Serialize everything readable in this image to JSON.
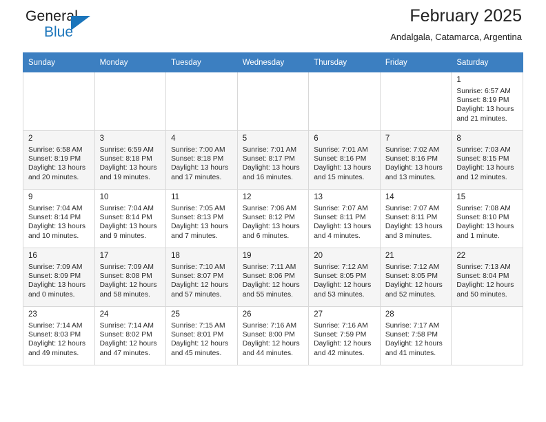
{
  "brand": {
    "name_top": "General",
    "name_bottom": "Blue",
    "accent_color": "#1b75bb"
  },
  "header": {
    "title": "February 2025",
    "subtitle": "Andalgala, Catamarca, Argentina"
  },
  "theme": {
    "header_row_bg": "#3c7fc1",
    "header_row_text": "#ffffff",
    "alt_row_bg": "#f5f5f5",
    "grid_border": "#d8d8d8"
  },
  "weekday_headers": [
    "Sunday",
    "Monday",
    "Tuesday",
    "Wednesday",
    "Thursday",
    "Friday",
    "Saturday"
  ],
  "weeks": [
    [
      {
        "empty": true
      },
      {
        "empty": true
      },
      {
        "empty": true
      },
      {
        "empty": true
      },
      {
        "empty": true
      },
      {
        "empty": true
      },
      {
        "day": "1",
        "sunrise": "Sunrise: 6:57 AM",
        "sunset": "Sunset: 8:19 PM",
        "daylight": "Daylight: 13 hours and 21 minutes."
      }
    ],
    [
      {
        "day": "2",
        "sunrise": "Sunrise: 6:58 AM",
        "sunset": "Sunset: 8:19 PM",
        "daylight": "Daylight: 13 hours and 20 minutes."
      },
      {
        "day": "3",
        "sunrise": "Sunrise: 6:59 AM",
        "sunset": "Sunset: 8:18 PM",
        "daylight": "Daylight: 13 hours and 19 minutes."
      },
      {
        "day": "4",
        "sunrise": "Sunrise: 7:00 AM",
        "sunset": "Sunset: 8:18 PM",
        "daylight": "Daylight: 13 hours and 17 minutes."
      },
      {
        "day": "5",
        "sunrise": "Sunrise: 7:01 AM",
        "sunset": "Sunset: 8:17 PM",
        "daylight": "Daylight: 13 hours and 16 minutes."
      },
      {
        "day": "6",
        "sunrise": "Sunrise: 7:01 AM",
        "sunset": "Sunset: 8:16 PM",
        "daylight": "Daylight: 13 hours and 15 minutes."
      },
      {
        "day": "7",
        "sunrise": "Sunrise: 7:02 AM",
        "sunset": "Sunset: 8:16 PM",
        "daylight": "Daylight: 13 hours and 13 minutes."
      },
      {
        "day": "8",
        "sunrise": "Sunrise: 7:03 AM",
        "sunset": "Sunset: 8:15 PM",
        "daylight": "Daylight: 13 hours and 12 minutes."
      }
    ],
    [
      {
        "day": "9",
        "sunrise": "Sunrise: 7:04 AM",
        "sunset": "Sunset: 8:14 PM",
        "daylight": "Daylight: 13 hours and 10 minutes."
      },
      {
        "day": "10",
        "sunrise": "Sunrise: 7:04 AM",
        "sunset": "Sunset: 8:14 PM",
        "daylight": "Daylight: 13 hours and 9 minutes."
      },
      {
        "day": "11",
        "sunrise": "Sunrise: 7:05 AM",
        "sunset": "Sunset: 8:13 PM",
        "daylight": "Daylight: 13 hours and 7 minutes."
      },
      {
        "day": "12",
        "sunrise": "Sunrise: 7:06 AM",
        "sunset": "Sunset: 8:12 PM",
        "daylight": "Daylight: 13 hours and 6 minutes."
      },
      {
        "day": "13",
        "sunrise": "Sunrise: 7:07 AM",
        "sunset": "Sunset: 8:11 PM",
        "daylight": "Daylight: 13 hours and 4 minutes."
      },
      {
        "day": "14",
        "sunrise": "Sunrise: 7:07 AM",
        "sunset": "Sunset: 8:11 PM",
        "daylight": "Daylight: 13 hours and 3 minutes."
      },
      {
        "day": "15",
        "sunrise": "Sunrise: 7:08 AM",
        "sunset": "Sunset: 8:10 PM",
        "daylight": "Daylight: 13 hours and 1 minute."
      }
    ],
    [
      {
        "day": "16",
        "sunrise": "Sunrise: 7:09 AM",
        "sunset": "Sunset: 8:09 PM",
        "daylight": "Daylight: 13 hours and 0 minutes."
      },
      {
        "day": "17",
        "sunrise": "Sunrise: 7:09 AM",
        "sunset": "Sunset: 8:08 PM",
        "daylight": "Daylight: 12 hours and 58 minutes."
      },
      {
        "day": "18",
        "sunrise": "Sunrise: 7:10 AM",
        "sunset": "Sunset: 8:07 PM",
        "daylight": "Daylight: 12 hours and 57 minutes."
      },
      {
        "day": "19",
        "sunrise": "Sunrise: 7:11 AM",
        "sunset": "Sunset: 8:06 PM",
        "daylight": "Daylight: 12 hours and 55 minutes."
      },
      {
        "day": "20",
        "sunrise": "Sunrise: 7:12 AM",
        "sunset": "Sunset: 8:05 PM",
        "daylight": "Daylight: 12 hours and 53 minutes."
      },
      {
        "day": "21",
        "sunrise": "Sunrise: 7:12 AM",
        "sunset": "Sunset: 8:05 PM",
        "daylight": "Daylight: 12 hours and 52 minutes."
      },
      {
        "day": "22",
        "sunrise": "Sunrise: 7:13 AM",
        "sunset": "Sunset: 8:04 PM",
        "daylight": "Daylight: 12 hours and 50 minutes."
      }
    ],
    [
      {
        "day": "23",
        "sunrise": "Sunrise: 7:14 AM",
        "sunset": "Sunset: 8:03 PM",
        "daylight": "Daylight: 12 hours and 49 minutes."
      },
      {
        "day": "24",
        "sunrise": "Sunrise: 7:14 AM",
        "sunset": "Sunset: 8:02 PM",
        "daylight": "Daylight: 12 hours and 47 minutes."
      },
      {
        "day": "25",
        "sunrise": "Sunrise: 7:15 AM",
        "sunset": "Sunset: 8:01 PM",
        "daylight": "Daylight: 12 hours and 45 minutes."
      },
      {
        "day": "26",
        "sunrise": "Sunrise: 7:16 AM",
        "sunset": "Sunset: 8:00 PM",
        "daylight": "Daylight: 12 hours and 44 minutes."
      },
      {
        "day": "27",
        "sunrise": "Sunrise: 7:16 AM",
        "sunset": "Sunset: 7:59 PM",
        "daylight": "Daylight: 12 hours and 42 minutes."
      },
      {
        "day": "28",
        "sunrise": "Sunrise: 7:17 AM",
        "sunset": "Sunset: 7:58 PM",
        "daylight": "Daylight: 12 hours and 41 minutes."
      },
      {
        "empty": true
      }
    ]
  ]
}
